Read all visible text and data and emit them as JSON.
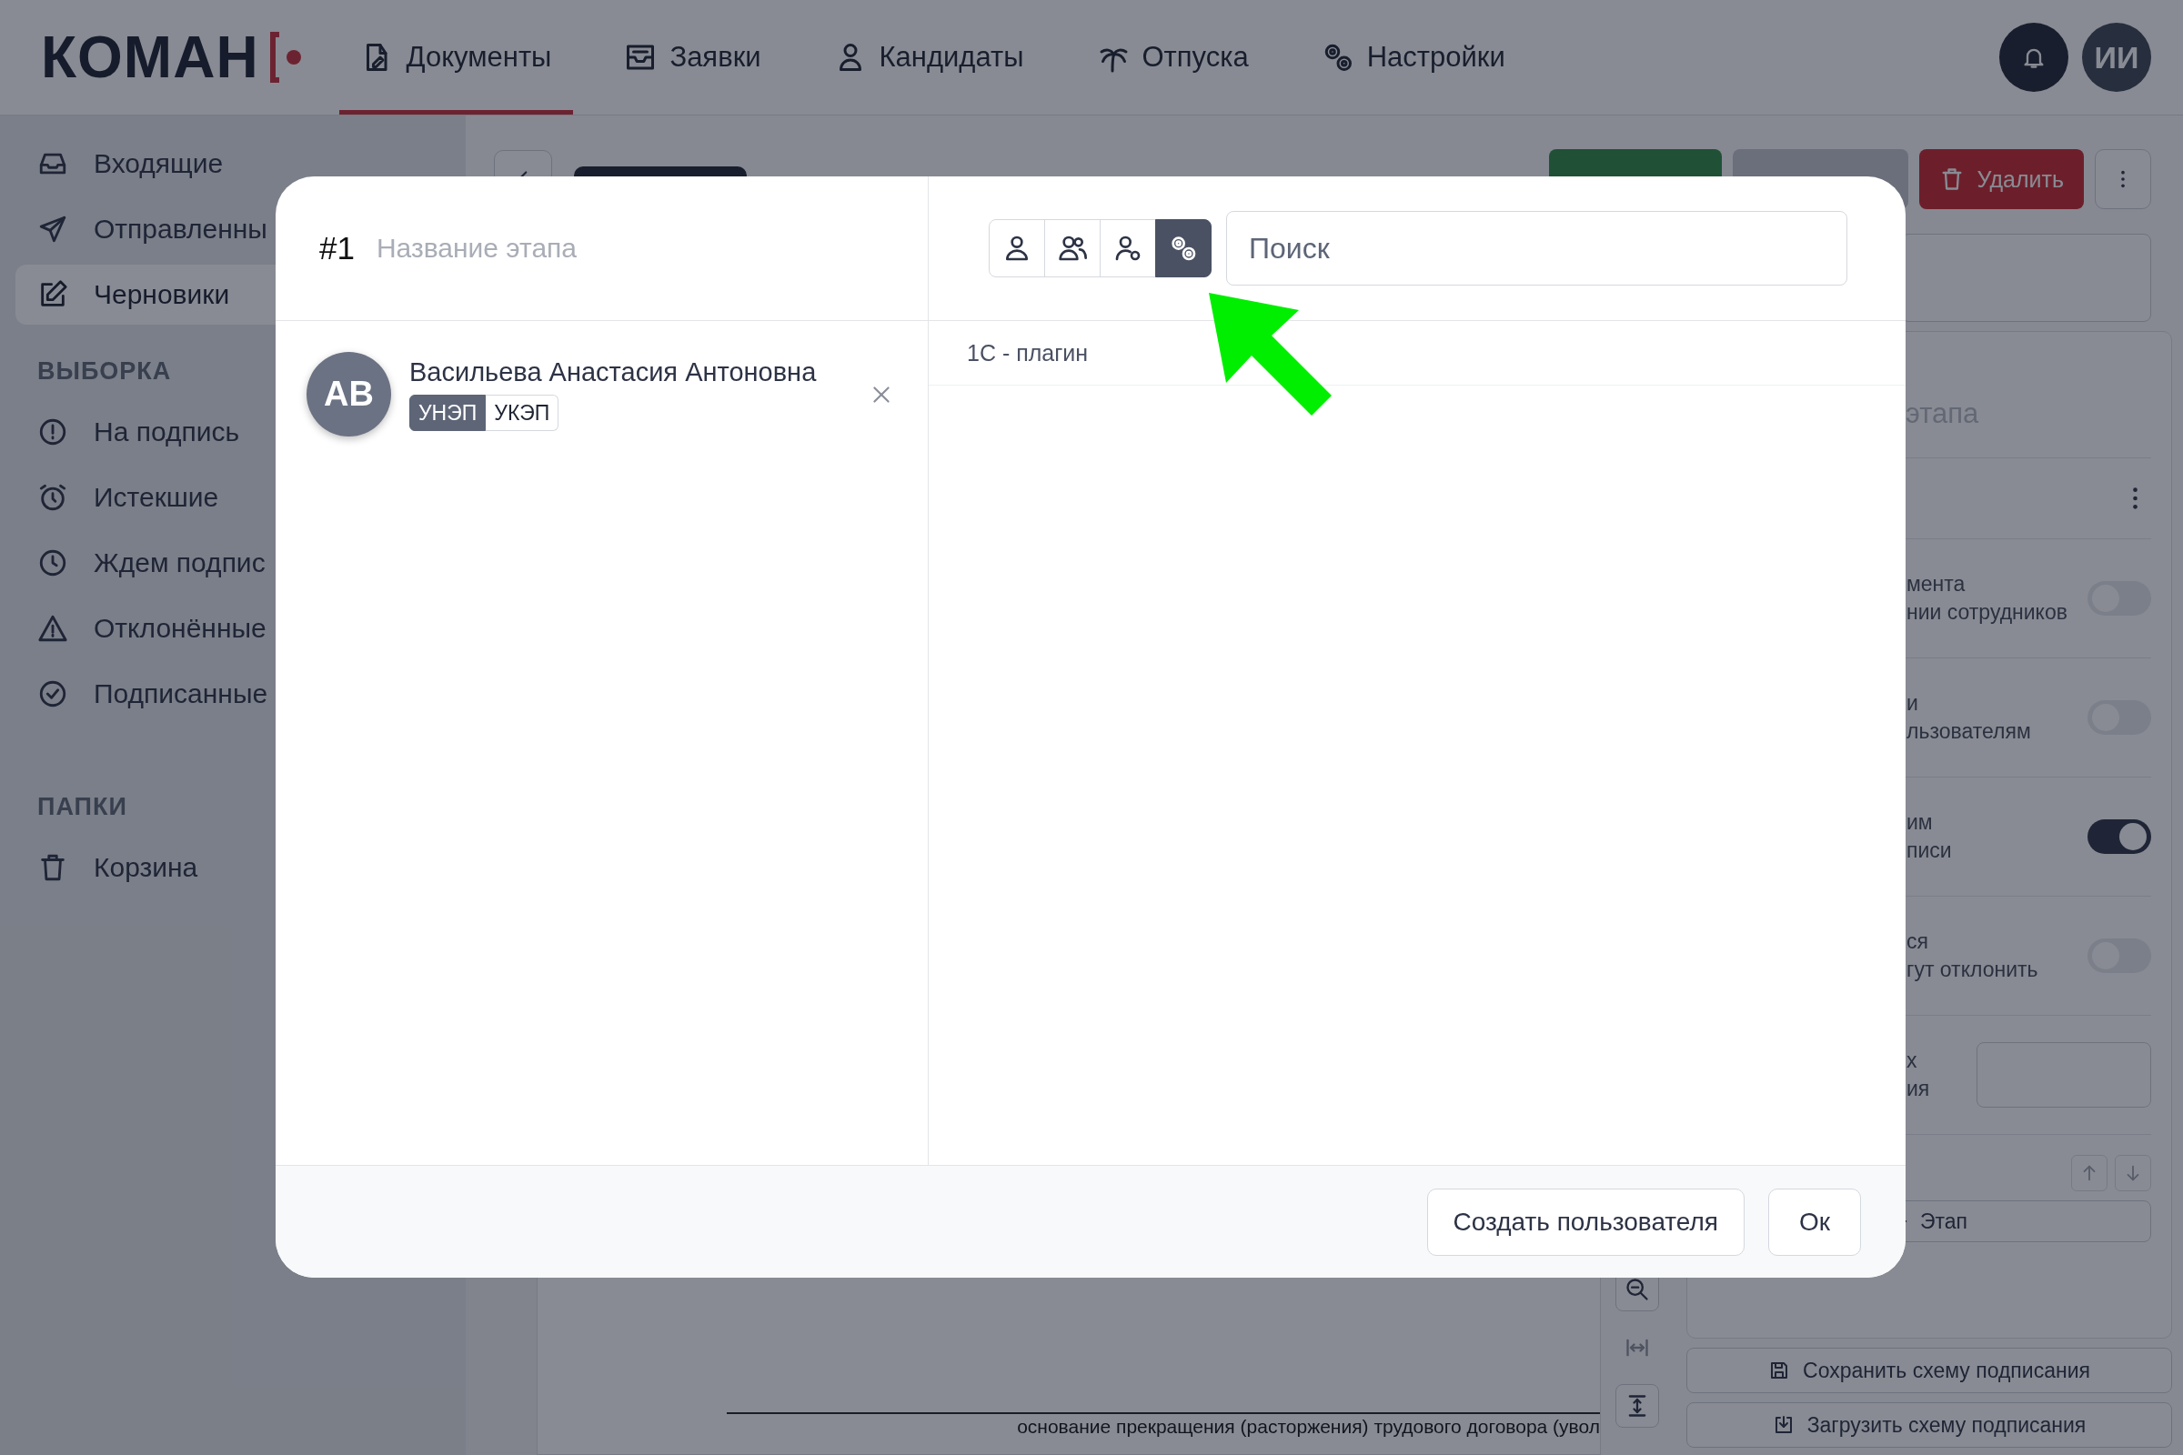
{
  "header": {
    "logo": "КОМАН",
    "nav": [
      {
        "label": "Документы",
        "selected": true
      },
      {
        "label": "Заявки",
        "selected": false
      },
      {
        "label": "Кандидаты",
        "selected": false
      },
      {
        "label": "Отпуска",
        "selected": false
      },
      {
        "label": "Настройки",
        "selected": false
      }
    ],
    "avatar": "ИИ"
  },
  "sidebar": {
    "items": [
      {
        "label": "Входящие",
        "selected": false
      },
      {
        "label": "Отправленны",
        "selected": false
      },
      {
        "label": "Черновики",
        "selected": true
      }
    ],
    "sections": [
      {
        "title": "ВЫБОРКА",
        "items": [
          {
            "label": "На подпись",
            "selected": false
          },
          {
            "label": "Истекшие",
            "selected": false
          },
          {
            "label": "Ждем подпис",
            "selected": false
          },
          {
            "label": "Отклонённые",
            "selected": false
          },
          {
            "label": "Подписанные",
            "selected": false
          }
        ]
      },
      {
        "title": "ПАПКИ",
        "items": [
          {
            "label": "Корзина",
            "selected": false
          }
        ]
      }
    ]
  },
  "toolbar": {
    "delete": "Удалить"
  },
  "document": {
    "text": "основание прекращения (расторжения) трудового договора (увол"
  },
  "stage_panel": {
    "name_placeholder": "этапа",
    "settings": [
      {
        "kind": "toggle",
        "lines": [
          "мента",
          "нии сотрудников"
        ],
        "on": false
      },
      {
        "kind": "toggle",
        "lines": [
          "и",
          "льзователям"
        ],
        "on": false
      },
      {
        "kind": "toggle",
        "lines": [
          "им",
          "писи"
        ],
        "on": true
      },
      {
        "kind": "toggle",
        "lines": [
          "ся",
          "гут отклонить"
        ],
        "on": false
      },
      {
        "kind": "input",
        "lines": [
          "х",
          "ия"
        ]
      }
    ],
    "add_stage": "Этап",
    "save_scheme": "Сохранить схему подписания",
    "load_scheme": "Загрузить схему подписания"
  },
  "modal": {
    "number": "#1",
    "name_placeholder": "Название этапа",
    "signers": [
      {
        "initials": "АВ",
        "name": "Васильева Анастасия Антоновна",
        "signature_types": [
          {
            "label": "УНЭП",
            "selected": true
          },
          {
            "label": "УКЭП",
            "selected": false
          }
        ]
      }
    ],
    "filter_buttons": [
      {
        "selected": false
      },
      {
        "selected": false
      },
      {
        "selected": false
      },
      {
        "selected": true
      }
    ],
    "search": {
      "placeholder": "Поиск"
    },
    "results": [
      "1С - плагин"
    ],
    "buttons": [
      "Создать пользователя",
      "Ок"
    ]
  }
}
